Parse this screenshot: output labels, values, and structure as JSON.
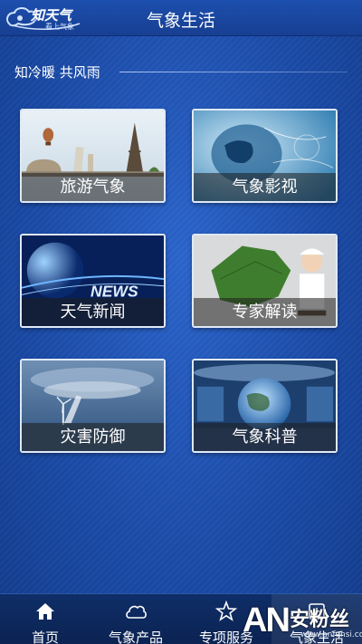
{
  "header": {
    "logo_text": "知天气",
    "logo_subtext": "看上气象",
    "title": "气象生活"
  },
  "section": {
    "title": "知冷暖 共风雨"
  },
  "tiles": [
    {
      "label": "旅游气象",
      "icon": "travel-landmarks-image"
    },
    {
      "label": "气象影视",
      "icon": "globe-weather-tv-image"
    },
    {
      "label": "天气新闻",
      "icon": "news-globe-image"
    },
    {
      "label": "专家解读",
      "icon": "expert-map-image"
    },
    {
      "label": "灾害防御",
      "icon": "tornado-image"
    },
    {
      "label": "气象科普",
      "icon": "science-globe-image"
    }
  ],
  "bottom_nav": [
    {
      "label": "首页",
      "icon": "home-icon"
    },
    {
      "label": "气象产品",
      "icon": "cloud-icon"
    },
    {
      "label": "专项服务",
      "icon": "star-icon"
    },
    {
      "label": "气象生活",
      "icon": "life-icon",
      "active": true
    }
  ],
  "watermark": {
    "brand": "AN",
    "text": "安粉丝",
    "url": "www.anfensi.com"
  },
  "colors": {
    "background": "#1a49a8",
    "header": "#173f92",
    "nav": "#0b2352",
    "tile_label_bg": "rgba(30,30,30,0.55)"
  }
}
